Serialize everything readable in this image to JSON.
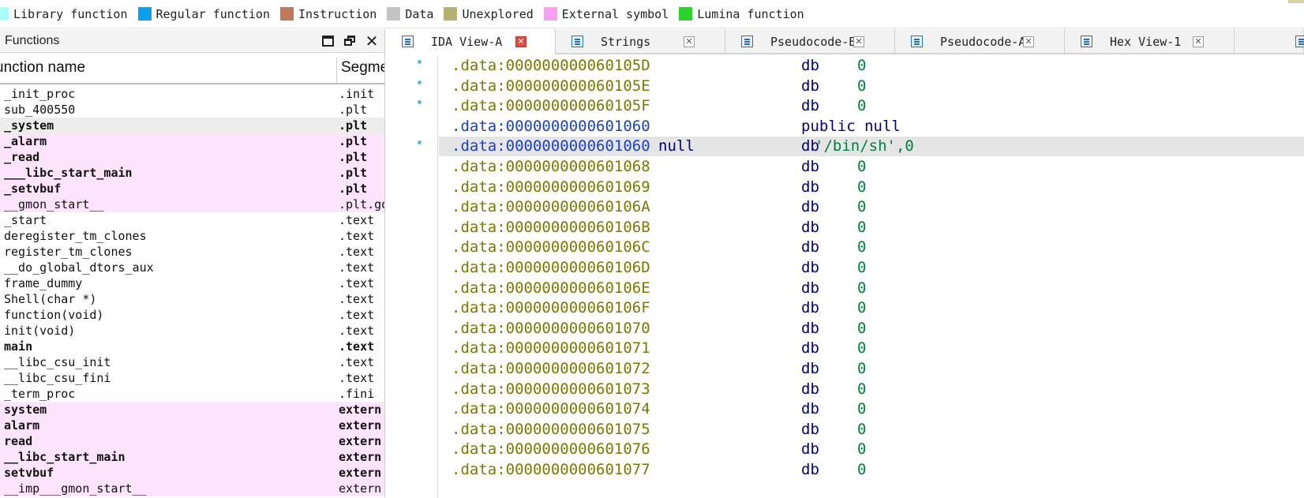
{
  "legend": [
    {
      "label": "Library function",
      "color": "#a8ffff"
    },
    {
      "label": "Regular function",
      "color": "#0aa0ee"
    },
    {
      "label": "Instruction",
      "color": "#c0795a"
    },
    {
      "label": "Data",
      "color": "#c4c4c4"
    },
    {
      "label": "Unexplored",
      "color": "#b5b271"
    },
    {
      "label": "External symbol",
      "color": "#ff9ef5"
    },
    {
      "label": "Lumina function",
      "color": "#2bd42b"
    }
  ],
  "functions": {
    "title": "Functions",
    "col_name": "unction name",
    "col_segment": "Segme",
    "rows": [
      {
        "name": "_init_proc",
        "seg": ".init",
        "style": ""
      },
      {
        "name": "sub_400550",
        "seg": ".plt",
        "style": ""
      },
      {
        "name": "_system",
        "seg": ".plt",
        "style": "bold sel"
      },
      {
        "name": "_alarm",
        "seg": ".plt",
        "style": "bold ext"
      },
      {
        "name": "_read",
        "seg": ".plt",
        "style": "bold ext"
      },
      {
        "name": "___libc_start_main",
        "seg": ".plt",
        "style": "bold ext"
      },
      {
        "name": "_setvbuf",
        "seg": ".plt",
        "style": "bold ext"
      },
      {
        "name": "__gmon_start__",
        "seg": ".plt.go",
        "style": "ext"
      },
      {
        "name": "_start",
        "seg": ".text",
        "style": ""
      },
      {
        "name": "deregister_tm_clones",
        "seg": ".text",
        "style": ""
      },
      {
        "name": "register_tm_clones",
        "seg": ".text",
        "style": ""
      },
      {
        "name": "__do_global_dtors_aux",
        "seg": ".text",
        "style": ""
      },
      {
        "name": "frame_dummy",
        "seg": ".text",
        "style": ""
      },
      {
        "name": "Shell(char *)",
        "seg": ".text",
        "style": ""
      },
      {
        "name": "function(void)",
        "seg": ".text",
        "style": ""
      },
      {
        "name": "init(void)",
        "seg": ".text",
        "style": ""
      },
      {
        "name": "main",
        "seg": ".text",
        "style": "bold"
      },
      {
        "name": "__libc_csu_init",
        "seg": ".text",
        "style": ""
      },
      {
        "name": "__libc_csu_fini",
        "seg": ".text",
        "style": ""
      },
      {
        "name": "_term_proc",
        "seg": ".fini",
        "style": ""
      },
      {
        "name": "system",
        "seg": "extern",
        "style": "bold ext"
      },
      {
        "name": "alarm",
        "seg": "extern",
        "style": "bold ext"
      },
      {
        "name": "read",
        "seg": "extern",
        "style": "bold ext"
      },
      {
        "name": "__libc_start_main",
        "seg": "extern",
        "style": "bold ext"
      },
      {
        "name": "setvbuf",
        "seg": "extern",
        "style": "bold ext"
      },
      {
        "name": "__imp___gmon_start__",
        "seg": "extern",
        "style": "ext"
      }
    ]
  },
  "tabs": [
    {
      "label": "IDA View-A",
      "active": true
    },
    {
      "label": "Strings",
      "active": false
    },
    {
      "label": "Pseudocode-B",
      "active": false
    },
    {
      "label": "Pseudocode-A",
      "active": false
    },
    {
      "label": "Hex View-1",
      "active": false
    }
  ],
  "code_lines": [
    {
      "addr": ".data:000000000060105D",
      "label": "",
      "op": "db",
      "val": "0",
      "kind": "data",
      "dot": true
    },
    {
      "addr": ".data:000000000060105E",
      "label": "",
      "op": "db",
      "val": "0",
      "kind": "data",
      "dot": true
    },
    {
      "addr": ".data:000000000060105F",
      "label": "",
      "op": "db",
      "val": "0",
      "kind": "data",
      "dot": true
    },
    {
      "addr": ".data:0000000000601060",
      "label": "",
      "op": "public null",
      "val": "",
      "kind": "pub",
      "dot": false
    },
    {
      "addr": ".data:0000000000601060",
      "label": "null",
      "op": "db",
      "val": "'/bin/sh',0",
      "kind": "cur",
      "dot": true
    },
    {
      "addr": ".data:0000000000601068",
      "label": "",
      "op": "db",
      "val": "0",
      "kind": "data",
      "dot": false
    },
    {
      "addr": ".data:0000000000601069",
      "label": "",
      "op": "db",
      "val": "0",
      "kind": "data",
      "dot": false
    },
    {
      "addr": ".data:000000000060106A",
      "label": "",
      "op": "db",
      "val": "0",
      "kind": "data",
      "dot": false
    },
    {
      "addr": ".data:000000000060106B",
      "label": "",
      "op": "db",
      "val": "0",
      "kind": "data",
      "dot": false
    },
    {
      "addr": ".data:000000000060106C",
      "label": "",
      "op": "db",
      "val": "0",
      "kind": "data",
      "dot": false
    },
    {
      "addr": ".data:000000000060106D",
      "label": "",
      "op": "db",
      "val": "0",
      "kind": "data",
      "dot": false
    },
    {
      "addr": ".data:000000000060106E",
      "label": "",
      "op": "db",
      "val": "0",
      "kind": "data",
      "dot": false
    },
    {
      "addr": ".data:000000000060106F",
      "label": "",
      "op": "db",
      "val": "0",
      "kind": "data",
      "dot": false
    },
    {
      "addr": ".data:0000000000601070",
      "label": "",
      "op": "db",
      "val": "0",
      "kind": "data",
      "dot": false
    },
    {
      "addr": ".data:0000000000601071",
      "label": "",
      "op": "db",
      "val": "0",
      "kind": "data",
      "dot": false
    },
    {
      "addr": ".data:0000000000601072",
      "label": "",
      "op": "db",
      "val": "0",
      "kind": "data",
      "dot": false
    },
    {
      "addr": ".data:0000000000601073",
      "label": "",
      "op": "db",
      "val": "0",
      "kind": "data",
      "dot": false
    },
    {
      "addr": ".data:0000000000601074",
      "label": "",
      "op": "db",
      "val": "0",
      "kind": "data",
      "dot": false
    },
    {
      "addr": ".data:0000000000601075",
      "label": "",
      "op": "db",
      "val": "0",
      "kind": "data",
      "dot": false
    },
    {
      "addr": ".data:0000000000601076",
      "label": "",
      "op": "db",
      "val": "0",
      "kind": "data",
      "dot": false
    },
    {
      "addr": ".data:0000000000601077",
      "label": "",
      "op": "db",
      "val": "0",
      "kind": "data",
      "dot": false
    }
  ]
}
